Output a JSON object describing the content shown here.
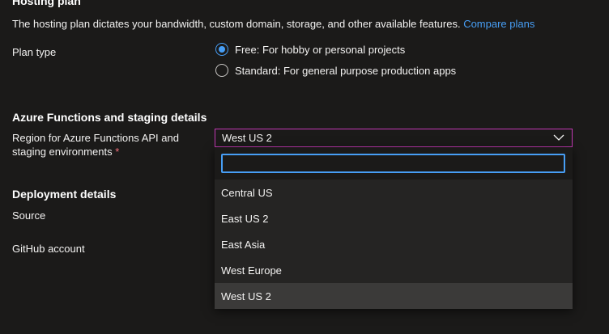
{
  "hosting": {
    "title": "Hosting plan",
    "description": "The hosting plan dictates your bandwidth, custom domain, storage, and other available features.",
    "compare_link": "Compare plans",
    "plan_type_label": "Plan type",
    "options": [
      {
        "label": "Free: For hobby or personal projects",
        "checked": true
      },
      {
        "label": "Standard: For general purpose production apps",
        "checked": false
      }
    ]
  },
  "azure": {
    "title": "Azure Functions and staging details",
    "region_label_line1": "Region for Azure Functions API and",
    "region_label_line2": "staging environments",
    "required_mark": "*",
    "region_value": "West US 2"
  },
  "dropdown": {
    "search_value": "",
    "options": [
      "Central US",
      "East US 2",
      "East Asia",
      "West Europe",
      "West US 2"
    ],
    "selected": "West US 2"
  },
  "deployment": {
    "title": "Deployment details",
    "source_label": "Source",
    "github_label": "GitHub account"
  },
  "colors": {
    "accent": "#479ef5",
    "focus_border": "#c239b3",
    "background": "#1b1a19"
  }
}
